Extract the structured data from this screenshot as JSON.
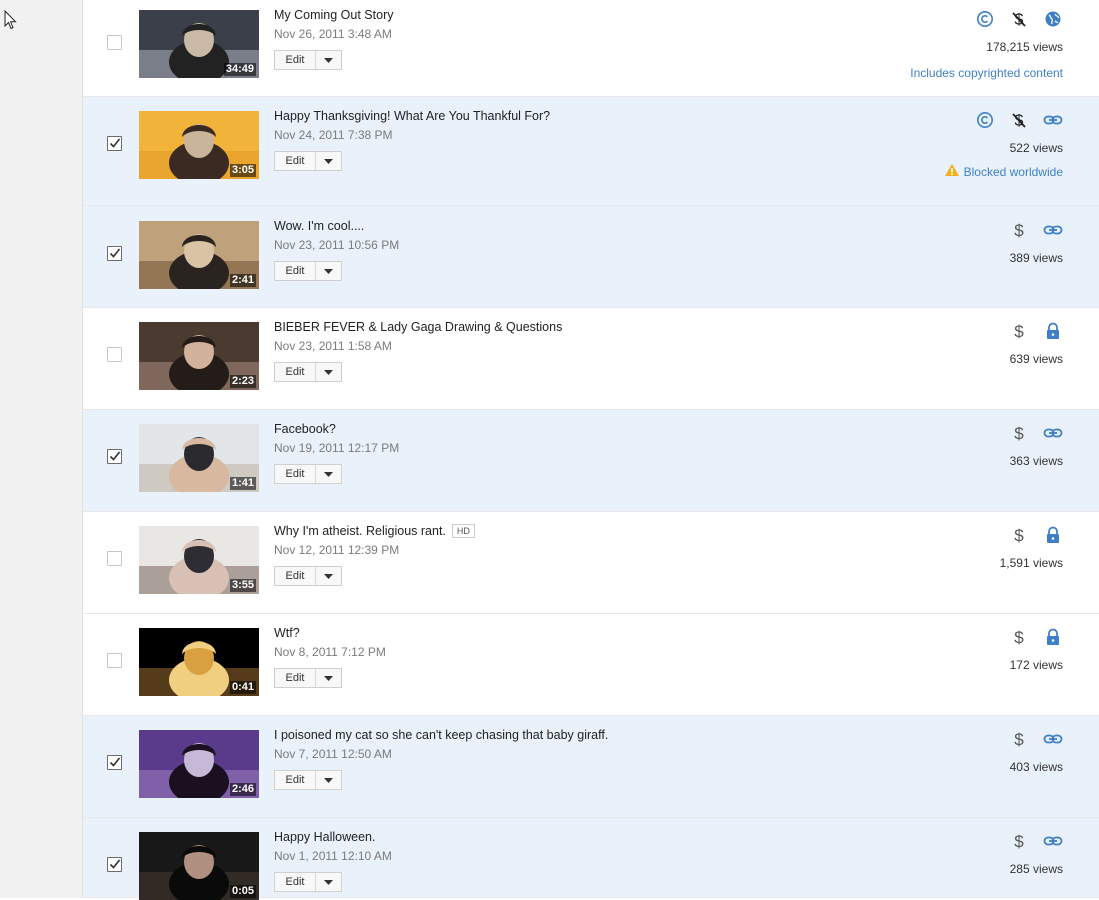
{
  "videos": [
    {
      "title": "My Coming Out Story",
      "date": "Nov 26, 2011 3:48 AM",
      "duration": "34:49",
      "views": "178,215 views",
      "selected": false,
      "hd": "",
      "status": "Includes copyrighted content",
      "status_warning": false,
      "icons": [
        "copyright-icon",
        "no-monetization-icon",
        "globe-icon"
      ],
      "thumb": [
        "#3a3f4a",
        "#8b8f99",
        "#c9b9a6",
        "#222"
      ]
    },
    {
      "title": "Happy Thanksgiving! What Are You Thankful For?",
      "date": "Nov 24, 2011 7:38 PM",
      "duration": "3:05",
      "views": "522 views",
      "selected": true,
      "hd": "",
      "status": "Blocked worldwide",
      "status_warning": true,
      "icons": [
        "copyright-icon",
        "no-monetization-icon",
        "link-icon"
      ],
      "thumb": [
        "#f2b33a",
        "#e6a12a",
        "#c8b59a",
        "#3a2a22"
      ]
    },
    {
      "title": "Wow. I'm cool....",
      "date": "Nov 23, 2011 10:56 PM",
      "duration": "2:41",
      "views": "389 views",
      "selected": true,
      "hd": "",
      "status": "",
      "status_warning": false,
      "icons": [
        "monetization-icon",
        "link-icon"
      ],
      "thumb": [
        "#bfa27c",
        "#8a6a4a",
        "#d8c3a3",
        "#2a2420"
      ]
    },
    {
      "title": "BIEBER FEVER & Lady Gaga Drawing & Questions",
      "date": "Nov 23, 2011 1:58 AM",
      "duration": "2:23",
      "views": "639 views",
      "selected": false,
      "hd": "",
      "status": "",
      "status_warning": false,
      "icons": [
        "monetization-icon",
        "lock-icon"
      ],
      "thumb": [
        "#4a3a30",
        "#8c7466",
        "#d2b29a",
        "#241c18"
      ]
    },
    {
      "title": "Facebook?",
      "date": "Nov 19, 2011 12:17 PM",
      "duration": "1:41",
      "views": "363 views",
      "selected": true,
      "hd": "",
      "status": "",
      "status_warning": false,
      "icons": [
        "monetization-icon",
        "link-icon"
      ],
      "thumb": [
        "#e3e6e8",
        "#c8c2b6",
        "#2a2a2e",
        "#d9b8a0"
      ]
    },
    {
      "title": "Why I'm atheist. Religious rant.",
      "date": "Nov 12, 2011 12:39 PM",
      "duration": "3:55",
      "views": "1,591 views",
      "selected": false,
      "hd": "HD",
      "status": "",
      "status_warning": false,
      "icons": [
        "monetization-icon",
        "lock-icon"
      ],
      "thumb": [
        "#e9e7e3",
        "#9a8f86",
        "#2d2d33",
        "#d8c0b4"
      ]
    },
    {
      "title": "Wtf?",
      "date": "Nov 8, 2011 7:12 PM",
      "duration": "0:41",
      "views": "172 views",
      "selected": false,
      "hd": "",
      "status": "",
      "status_warning": false,
      "icons": [
        "monetization-icon",
        "lock-icon"
      ],
      "thumb": [
        "#000000",
        "#6a4a20",
        "#d8a040",
        "#f0d080"
      ]
    },
    {
      "title": "I poisoned my cat so she can't keep chasing that baby giraff.",
      "date": "Nov 7, 2011 12:50 AM",
      "duration": "2:46",
      "views": "403 views",
      "selected": true,
      "hd": "",
      "status": "",
      "status_warning": false,
      "icons": [
        "monetization-icon",
        "link-icon"
      ],
      "thumb": [
        "#5a3a8a",
        "#8a6ab0",
        "#c8b8d8",
        "#1a1020"
      ]
    },
    {
      "title": "Happy Halloween.",
      "date": "Nov 1, 2011 12:10 AM",
      "duration": "0:05",
      "views": "285 views",
      "selected": true,
      "hd": "",
      "status": "",
      "status_warning": false,
      "icons": [
        "monetization-icon",
        "link-icon"
      ],
      "thumb": [
        "#181818",
        "#3a3028",
        "#b09080",
        "#0a0a0a"
      ]
    }
  ],
  "edit_label": "Edit",
  "colors": {
    "accent": "#3f7fc7",
    "icon_gray": "#555555",
    "warning": "#f2b01e",
    "selected_bg": "#e9f1fb"
  }
}
